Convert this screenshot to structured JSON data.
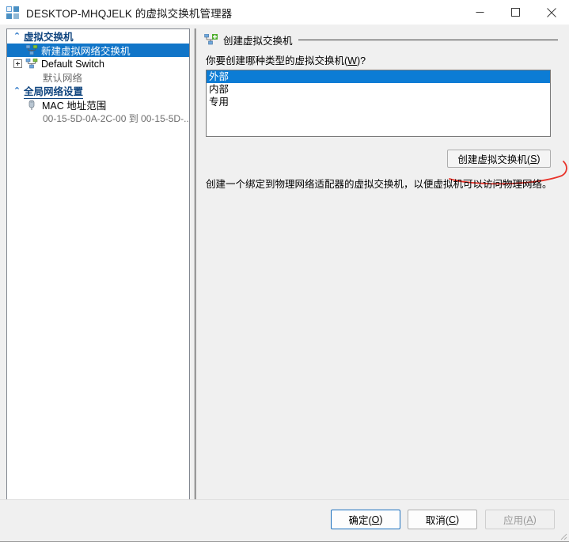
{
  "titlebar": {
    "icon": "hyperv-icon",
    "title": "DESKTOP-MHQJELK 的虚拟交换机管理器",
    "minimize": "minimize-icon",
    "maximize": "maximize-icon",
    "close": "close-icon"
  },
  "sidebar": {
    "groups": [
      {
        "label": "虚拟交换机",
        "chevron": "⌃",
        "items": [
          {
            "label": "新建虚拟网络交换机",
            "selected": true,
            "expandable": false,
            "sub": null
          },
          {
            "label": "Default Switch",
            "selected": false,
            "expandable": true,
            "sub": "默认网络"
          }
        ]
      },
      {
        "label": "全局网络设置",
        "chevron": "⌃",
        "items": [
          {
            "label": "MAC 地址范围",
            "selected": false,
            "expandable": false,
            "sub": "00-15-5D-0A-2C-00 到 00-15-5D-..."
          }
        ]
      }
    ]
  },
  "main": {
    "group_header": "创建虚拟交换机",
    "group_header_icon": "create-switch-icon",
    "prompt_before": "你要创建哪种类型的虚拟交换机(",
    "prompt_accel": "W",
    "prompt_after": ")?",
    "switch_types": [
      {
        "label": "外部",
        "selected": true
      },
      {
        "label": "内部",
        "selected": false
      },
      {
        "label": "专用",
        "selected": false
      }
    ],
    "create_button_before": "创建虚拟交换机(",
    "create_button_accel": "S",
    "create_button_after": ")",
    "description": "创建一个绑定到物理网络适配器的虚拟交换机，以便虚拟机可以访问物理网络。",
    "annotation_color": "#e8332a"
  },
  "footer": {
    "buttons": [
      {
        "id": "ok",
        "before": "确定(",
        "accel": "O",
        "after": ")",
        "state": "default"
      },
      {
        "id": "cancel",
        "before": "取消(",
        "accel": "C",
        "after": ")",
        "state": "normal"
      },
      {
        "id": "apply",
        "before": "应用(",
        "accel": "A",
        "after": ")",
        "state": "disabled"
      }
    ]
  },
  "colors": {
    "selection_blue": "#1175c8",
    "listbox_selection": "#0c7cd5",
    "group_label": "#10457f",
    "window_bg": "#f0f0f0",
    "annotation_red": "#e8332a"
  }
}
